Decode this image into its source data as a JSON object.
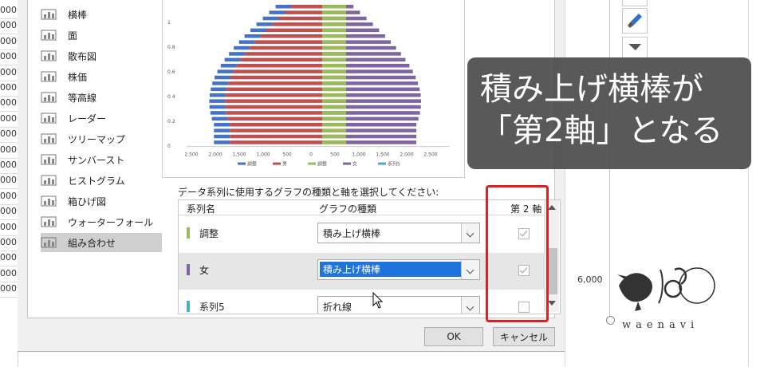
{
  "sheet_left": {
    "row_values": [
      "000",
      "000",
      "000",
      "000",
      "000",
      "000",
      "000",
      "000",
      "000",
      "000",
      "000",
      "000",
      "000",
      "000",
      "000",
      "000",
      "000",
      "000",
      "000"
    ]
  },
  "chart_types": [
    {
      "label": "横棒",
      "icon": "bar-chart-icon"
    },
    {
      "label": "面",
      "icon": "area-chart-icon"
    },
    {
      "label": "散布図",
      "icon": "scatter-chart-icon"
    },
    {
      "label": "株価",
      "icon": "stock-chart-icon"
    },
    {
      "label": "等高線",
      "icon": "surface-chart-icon"
    },
    {
      "label": "レーダー",
      "icon": "radar-chart-icon"
    },
    {
      "label": "ツリーマップ",
      "icon": "treemap-chart-icon"
    },
    {
      "label": "サンバースト",
      "icon": "sunburst-chart-icon"
    },
    {
      "label": "ヒストグラム",
      "icon": "histogram-chart-icon"
    },
    {
      "label": "箱ひげ図",
      "icon": "boxplot-chart-icon"
    },
    {
      "label": "ウォーターフォール",
      "icon": "waterfall-chart-icon"
    },
    {
      "label": "組み合わせ",
      "icon": "combo-chart-icon",
      "selected": true
    }
  ],
  "preview": {
    "y_ticks": [
      "1",
      "0.8",
      "0.6",
      "0.4",
      "0.2",
      "0"
    ],
    "x_ticks": [
      "2,500",
      "2,000",
      "1,500",
      "1,000",
      "500",
      "0",
      "500",
      "1,000",
      "1,500",
      "2,000",
      "2,500"
    ],
    "legend": [
      "調整",
      "男",
      "調整",
      "女",
      "系列5"
    ],
    "colors": {
      "adjust": "#4472c4",
      "male": "#c0504d",
      "adjust2": "#9bbb59",
      "female": "#8064a2",
      "series5": "#4bacc6"
    }
  },
  "series_table": {
    "caption": "データ系列に使用するグラフの種類と軸を選択してください:",
    "col_name": "系列名",
    "col_type": "グラフの種類",
    "col_axis": "第 2 軸",
    "rows": [
      {
        "name": "調整",
        "type": "積み上げ横棒",
        "axis": true,
        "color": "#9bbb59"
      },
      {
        "name": "女",
        "type": "積み上げ横棒",
        "axis": true,
        "color": "#8064a2",
        "selected": true
      },
      {
        "name": "系列5",
        "type": "折れ線",
        "axis": false,
        "color": "#4bacc6"
      }
    ]
  },
  "buttons": {
    "ok": "OK",
    "cancel": "キャンセル"
  },
  "annotation": {
    "line1": "積み上げ横棒が",
    "line2": "「第2軸」となる"
  },
  "right_sheet": {
    "axis_value": "6,000",
    "logo_text": "waenavi"
  }
}
